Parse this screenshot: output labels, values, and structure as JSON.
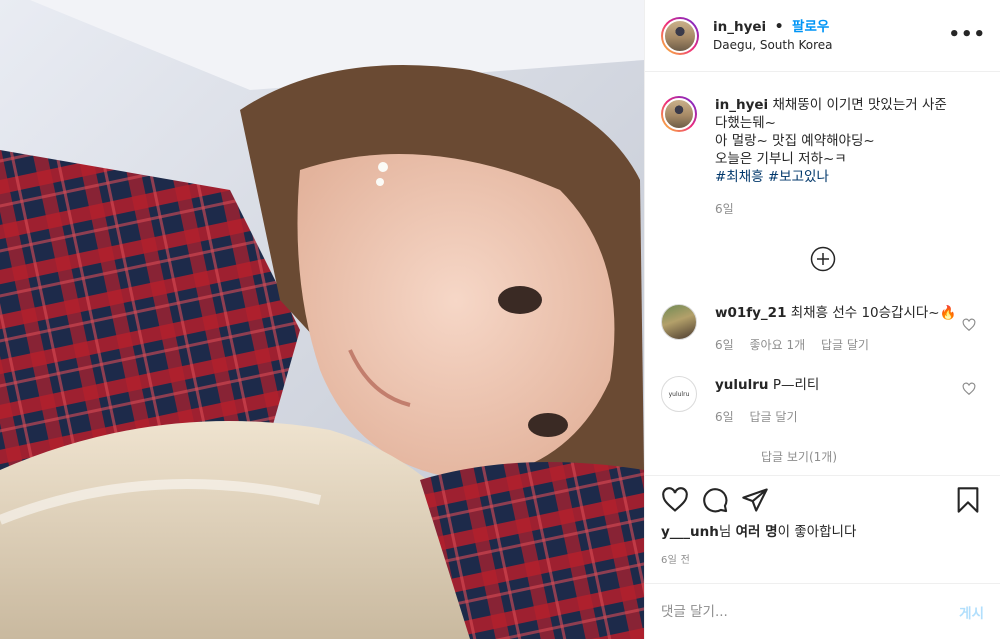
{
  "header": {
    "username": "in_hyei",
    "separator": "•",
    "follow_label": "팔로우",
    "location": "Daegu, South Korea"
  },
  "caption": {
    "username": "in_hyei",
    "line1": "채채뚱이 이기면 맛있는거 사준다했는뒈~",
    "line2": "아 멀랑~ 맛집 예약해야딩~",
    "line3": "오늘은 기부니 저하~ㅋ",
    "hashtag1": "#최채흥",
    "hashtag2": "#보고있나",
    "age": "6일"
  },
  "comments": [
    {
      "username": "w01fy_21",
      "text": "최채흥 선수 10승갑시다~🔥",
      "age": "6일",
      "likes": "좋아요 1개",
      "reply_label": "답글 달기"
    },
    {
      "username": "yululru",
      "text": "P—리티",
      "avatar_text": "yululru",
      "age": "6일",
      "reply_label": "답글 달기"
    }
  ],
  "view_replies": "답글 보기(1개)",
  "likes_line": {
    "user": "y___unh",
    "rest": "님 ",
    "others": "여러 명",
    "suffix": "이 좋아합니다"
  },
  "time_ago": "6일 전",
  "comment_input": {
    "placeholder": "댓글 달기...",
    "post_label": "게시"
  },
  "icons": [
    "more-icon",
    "add-comments-icon",
    "heart-icon",
    "comment-icon",
    "share-icon",
    "save-icon"
  ],
  "colors": {
    "link": "#0095f6",
    "hashtag": "#00376b",
    "muted": "#8e8e8e",
    "post_disabled": "#b2dffc"
  }
}
